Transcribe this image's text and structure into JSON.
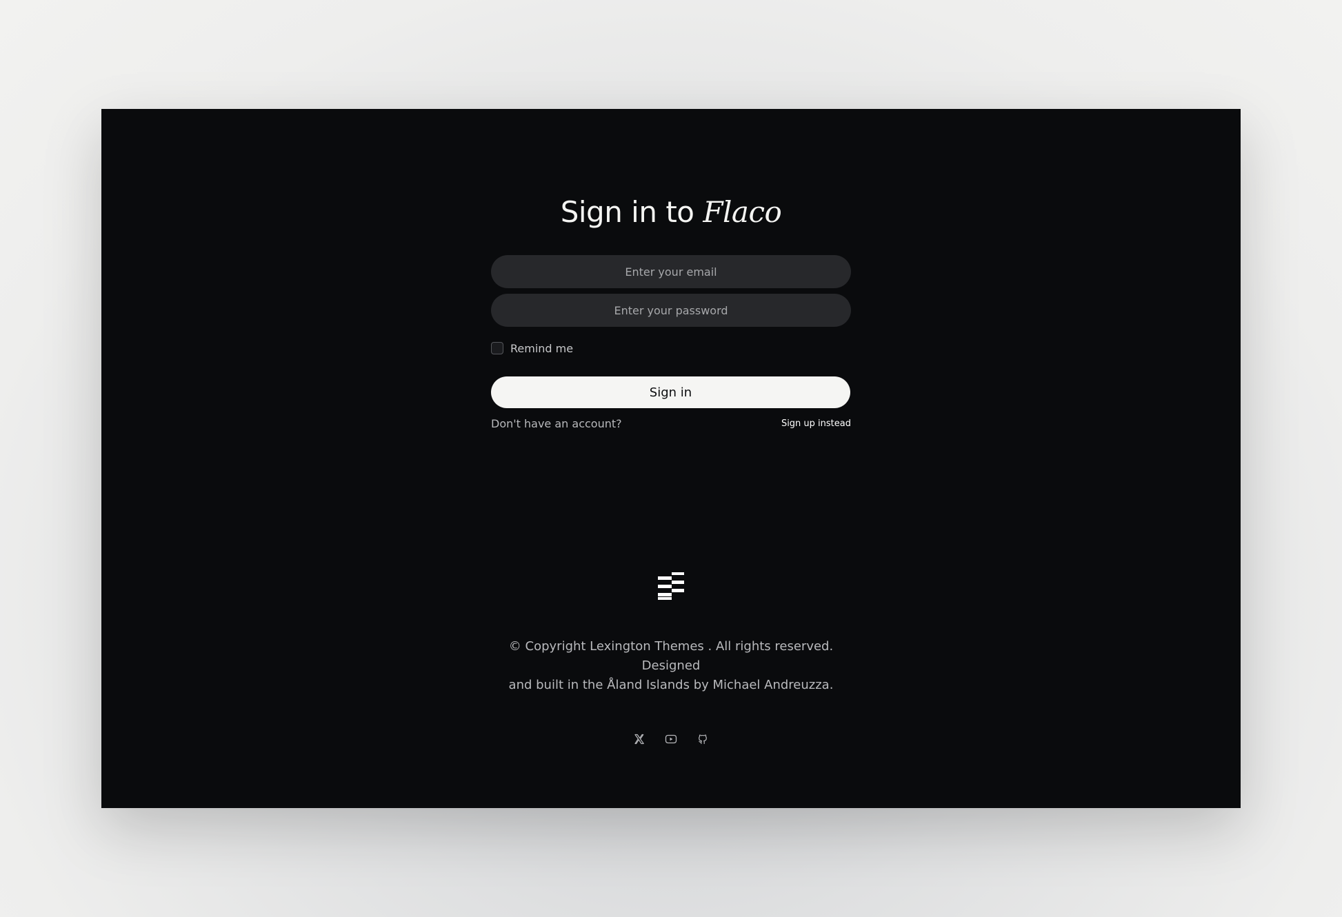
{
  "auth": {
    "title_prefix": "Sign in to",
    "title_brand": "Flaco",
    "email_placeholder": "Enter your email",
    "password_placeholder": "Enter your password",
    "remember_label": "Remind me",
    "signin_label": "Sign in",
    "account_prompt": "Don't have an account?",
    "signup_label": "Sign up instead"
  },
  "footer": {
    "logo_icon": "stacked-bars-logo-icon",
    "copyright_line1": "© Copyright Lexington Themes . All rights reserved. Designed",
    "copyright_line2": "and built in the Åland Islands by Michael Andreuzza.",
    "social": [
      {
        "icon": "x-twitter-icon"
      },
      {
        "icon": "youtube-icon"
      },
      {
        "icon": "github-icon"
      }
    ]
  },
  "colors": {
    "frame_background": "#0a0b0d",
    "input_background": "#27282b",
    "button_background": "#f5f5f3",
    "text_primary": "#f4f4f2",
    "text_muted": "#b9babd"
  }
}
